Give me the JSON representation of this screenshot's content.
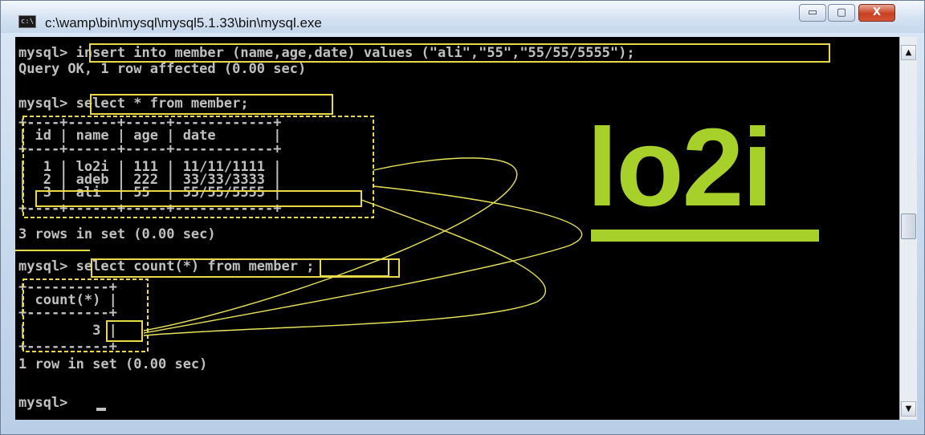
{
  "window": {
    "title": "c:\\wamp\\bin\\mysql\\mysql5.1.33\\bin\\mysql.exe",
    "app_icon": "c:\\",
    "buttons": {
      "minimize": "▭",
      "maximize": "▢",
      "close": "X"
    }
  },
  "console": {
    "lines": [
      "mysql> insert into member (name,age,date) values (\"ali\",\"55\",\"55/55/5555\");",
      "Query OK, 1 row affected (0.00 sec)",
      "",
      "mysql> select * from member;",
      "+----+------+-----+------------+",
      "| id | name | age | date       |",
      "+----+------+-----+------------+",
      "|  1 | lo2i | 111 | 11/11/1111 |",
      "|  2 | adeb | 222 | 33/33/3333 |",
      "|  3 | ali  | 55  | 55/55/5555 |",
      "+----+------+-----+------------+",
      "3 rows in set (0.00 sec)",
      "",
      "mysql> select count(*) from member ;",
      "+----------+",
      "| count(*) |",
      "+----------+",
      "|        3 |",
      "+----------+",
      "1 row in set (0.00 sec)",
      "",
      "mysql> "
    ]
  },
  "logo": {
    "text": "lo2i",
    "color": "#a8d02b"
  },
  "annotation_color": "#e8d84a",
  "scrollbar": {
    "up_arrow": "▲",
    "down_arrow": "▼"
  }
}
